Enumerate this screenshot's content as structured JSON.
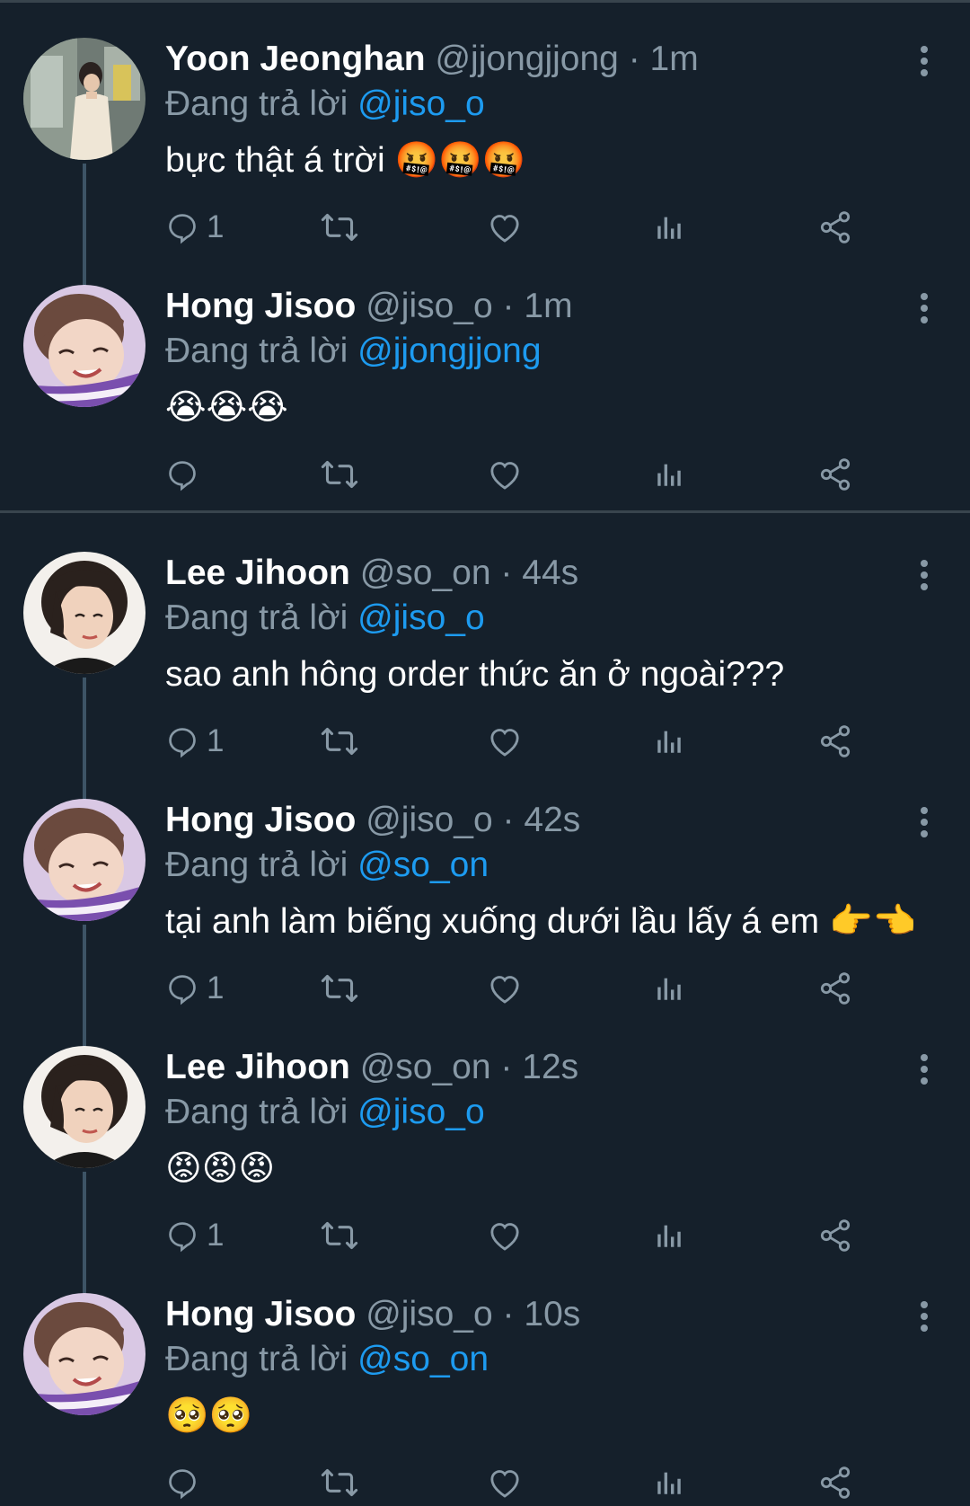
{
  "reply_prefix": "Đang trả lời",
  "colors": {
    "background": "#15202b",
    "secondary_text": "#8899a6",
    "mention": "#1d9bf0",
    "divider": "#38444d",
    "thread_line": "#3d5466"
  },
  "tweets": [
    {
      "name": "Yoon Jeonghan",
      "handle": "@jjongjjong",
      "separator": "·",
      "time": "1m",
      "reply_to": "@jiso_o",
      "text": "bực thật á trời",
      "emoji": "🤬🤬🤬",
      "reply_count": "1",
      "avatar": "avatar-jeonghan"
    },
    {
      "name": "Hong Jisoo",
      "handle": "@jiso_o",
      "separator": "·",
      "time": "1m",
      "reply_to": "@jjongjjong",
      "text": "",
      "emoji": "😭😭😭",
      "reply_count": "",
      "avatar": "avatar-jisoo"
    },
    {
      "name": "Lee Jihoon",
      "handle": "@so_on",
      "separator": "·",
      "time": "44s",
      "reply_to": "@jiso_o",
      "text": "sao anh hông order thức ăn ở ngoài???",
      "emoji": "",
      "reply_count": "1",
      "avatar": "avatar-jihoon"
    },
    {
      "name": "Hong Jisoo",
      "handle": "@jiso_o",
      "separator": "·",
      "time": "42s",
      "reply_to": "@so_on",
      "text": "tại anh làm biếng xuống dưới lầu lấy á em",
      "emoji": "👉👈",
      "reply_count": "1",
      "avatar": "avatar-jisoo"
    },
    {
      "name": "Lee Jihoon",
      "handle": "@so_on",
      "separator": "·",
      "time": "12s",
      "reply_to": "@jiso_o",
      "text": "",
      "emoji": "😡😡😡",
      "reply_count": "1",
      "avatar": "avatar-jihoon"
    },
    {
      "name": "Hong Jisoo",
      "handle": "@jiso_o",
      "separator": "·",
      "time": "10s",
      "reply_to": "@so_on",
      "text": "",
      "emoji": "🥺🥺",
      "reply_count": "",
      "avatar": "avatar-jisoo"
    }
  ]
}
